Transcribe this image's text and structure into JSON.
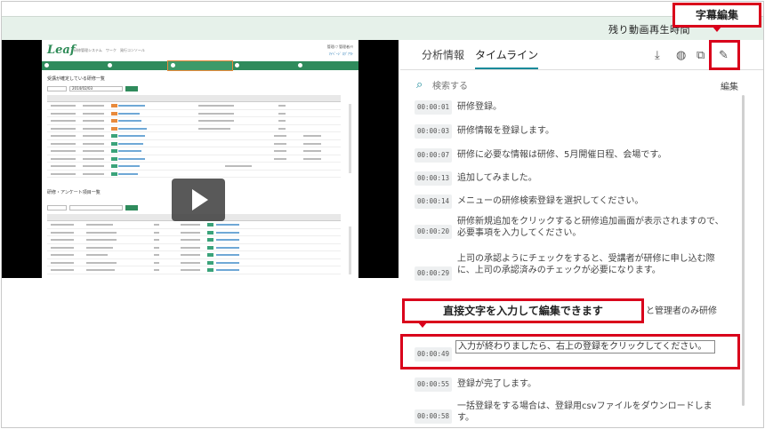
{
  "header": {
    "remaining_label": "残り動画再生時間"
  },
  "callouts": {
    "subtitle_edit": "字幕編集",
    "direct_edit": "直接文字を入力して編集できます"
  },
  "video": {
    "app_logo": "Leaf",
    "app_system": "研修管理システム　ワーク　発行コンソール",
    "app_user": "管理ﾉﾌ 管理者ﾃｷ",
    "app_user_links": "ﾏｲﾍﾟｰｼﾞ  ﾛｸﾞｱｳﾄ",
    "section1": "受講が確定している研修一覧",
    "section2": "研修・アンケート項目一覧",
    "search_date": "2014/02/03"
  },
  "panel": {
    "tabs": [
      "分析情報",
      "タイムライン"
    ],
    "active_tab": 1,
    "search_placeholder": "検索する",
    "edit_label": "編集",
    "icons": [
      "download-icon",
      "globe-icon",
      "layers-icon",
      "pencil-icon"
    ]
  },
  "timeline": [
    {
      "time": "00:00:01",
      "text": "研修登録。"
    },
    {
      "time": "00:00:03",
      "text": "研修情報を登録します。"
    },
    {
      "time": "00:00:07",
      "text": "研修に必要な情報は研修、5月開催日程、会場です。"
    },
    {
      "time": "00:00:13",
      "text": "追加してみました。"
    },
    {
      "time": "00:00:14",
      "text": "メニューの研修検索登録を選択してください。"
    },
    {
      "time": "00:00:20",
      "text": "研修新規追加をクリックすると研修追加画面が表示されますので、必要事項を入力してください。"
    },
    {
      "time": "00:00:29",
      "text": "上司の承認ようにチェックをすると、受講者が研修に申し込む際に、上司の承認済みのチェックが必要になります。"
    },
    {
      "time": "",
      "text": "と管理者のみ研修"
    },
    {
      "time": "00:00:49",
      "text": "入力が終わりましたら、右上の登録をクリックしてください。"
    },
    {
      "time": "00:00:55",
      "text": "登録が完了します。"
    },
    {
      "time": "00:00:58",
      "text": "一括登録をする場合は、登録用csvファイルをダウンロードします。"
    }
  ]
}
